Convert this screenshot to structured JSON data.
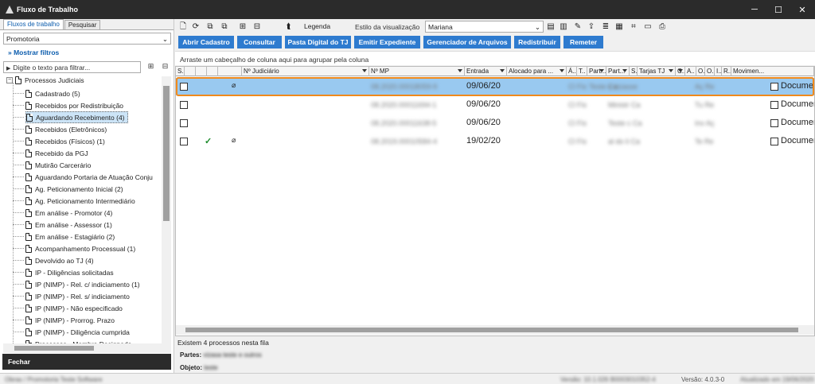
{
  "window": {
    "title": "Fluxo de Trabalho",
    "minimize": "─",
    "maximize": "☐",
    "close": "✕"
  },
  "left": {
    "tabs": [
      "Fluxos de trabalho",
      "Pesquisar"
    ],
    "dropdown": "Promotoria",
    "filters_label": "Mostrar filtros",
    "search_placeholder": "Digite o texto para filtrar...",
    "tree_root": "Processos Judiciais",
    "tree_items": [
      "Cadastrado (5)",
      "Recebidos por Redistribuição",
      "Aguardando Recebimento (4)",
      "Recebidos (Eletrônicos)",
      "Recebidos (Físicos) (1)",
      "Recebido da PGJ",
      "Mutirão Carcerário",
      "Aguardando Portaria de Atuação Conju",
      "Ag. Peticionamento Inicial (2)",
      "Ag. Peticionamento Intermediário",
      "Em análise - Promotor (4)",
      "Em análise - Assessor (1)",
      "Em análise - Estagiário (2)",
      "Acompanhamento Processual (1)",
      "Devolvido ao TJ (4)",
      "IP - Diligências solicitadas",
      "IP (NIMP) - Rel. c/ indiciamento (1)",
      "IP (NIMP) - Rel. s/ indiciamento",
      "IP (NIMP) - Não especificado",
      "IP (NIMP) - Prorrog. Prazo",
      "IP (NIMP) - Diligência cumprida",
      "Processos - Membro Designado"
    ],
    "close_label": "Fechar"
  },
  "toolbar": {
    "legenda": "Legenda",
    "estilo_label": "Estilo da visualização",
    "estilo_value": "Mariana",
    "icons": [
      "new-doc-icon",
      "refresh-icon",
      "copy-icon",
      "duplicate-icon",
      "group-icon",
      "merge-icon",
      "doc-arrow-icon",
      "legend-icon",
      "save-icon",
      "delete-icon",
      "edit-icon",
      "export-icon",
      "list-icon",
      "monitor-icon",
      "tree-icon",
      "print-preview-icon",
      "printer-icon"
    ]
  },
  "actions": [
    "Abrir Cadastro",
    "Consultar",
    "Pasta Digital do TJ",
    "Emitir Expediente",
    "Gerenciador de Arquivos",
    "Redistribuir",
    "Remeter"
  ],
  "group_hint": "Arraste um cabeçalho de coluna aqui para agrupar pela coluna",
  "columns": [
    "S..",
    "",
    "",
    "",
    "",
    "Nº Judiciário",
    "Nº MP",
    "Entrada",
    "Alocado para ...",
    "Á..",
    "T..",
    "Part...",
    "Part...",
    "S..",
    "Tarjas TJ",
    "C..",
    "A..",
    "O..",
    "O..",
    "I..",
    "R..",
    "Movimen..."
  ],
  "rows": [
    {
      "num_judicial": "",
      "num_mp": "08.2020.00018059-9",
      "entrada": "09/06/20",
      "checked": false,
      "clip": true,
      "cols_blur": [
        "Cl Fis",
        "Teste c vizasse",
        "Ca",
        "Aç Re"
      ],
      "mov": "Documer"
    },
    {
      "num_judicial": "",
      "num_mp": "08.2020.00011694-1",
      "entrada": "09/06/20",
      "checked": false,
      "clip": false,
      "cols_blur": [
        "Cl Fis",
        "",
        "Ministr Ca",
        "Tu Re"
      ],
      "mov": "Documer"
    },
    {
      "num_judicial": "",
      "num_mp": "08.2020.00011638-5",
      "entrada": "09/06/20",
      "checked": false,
      "clip": false,
      "cols_blur": [
        "Cl Fis",
        "",
        "Teste c Ca",
        "Inv Aç"
      ],
      "mov": "Documer"
    },
    {
      "num_judicial": "",
      "num_mp": "08.2019.00010584-4",
      "entrada": "19/02/20",
      "checked": true,
      "clip": true,
      "cols_blur": [
        "Cl Fis",
        "",
        "al do li Ca",
        "Te Re"
      ],
      "mov": "Documer"
    }
  ],
  "footer": {
    "count": "Existem 4 processos nesta fila",
    "partes_label": "Partes:",
    "partes_value": "vizasa teste e outros",
    "objeto_label": "Objeto:",
    "objeto_value": "teste"
  },
  "status": {
    "left": "Obras / Promotoria Teste Software",
    "version_blur": "Versão: 10.1.026 B0003010352-4",
    "version": "Versão: 4.0.3-0",
    "right_blur": "Atualizado em 19/06/2020"
  }
}
